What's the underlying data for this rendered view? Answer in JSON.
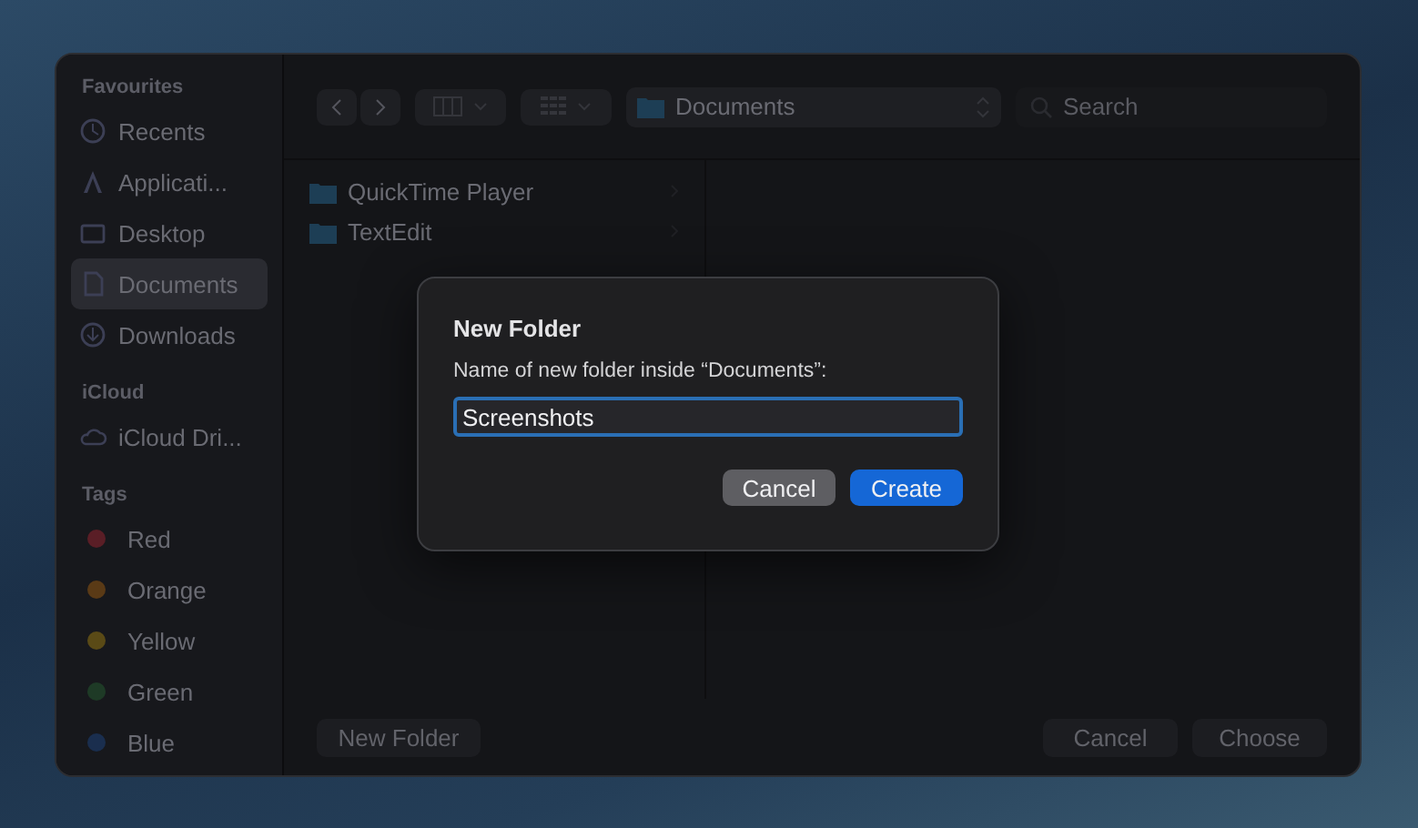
{
  "sidebar": {
    "sections": [
      {
        "title": "Favourites",
        "items": [
          {
            "label": "Recents",
            "kind": "clock",
            "selected": false
          },
          {
            "label": "Applicati...",
            "kind": "apps",
            "selected": false
          },
          {
            "label": "Desktop",
            "kind": "desktop",
            "selected": false
          },
          {
            "label": "Documents",
            "kind": "doc",
            "selected": true
          },
          {
            "label": "Downloads",
            "kind": "download",
            "selected": false
          }
        ]
      },
      {
        "title": "iCloud",
        "items": [
          {
            "label": "iCloud Dri...",
            "kind": "cloud",
            "selected": false
          }
        ]
      },
      {
        "title": "Tags",
        "items": [
          {
            "label": "Red",
            "kind": "tag",
            "color": "#5a1e26",
            "selected": false
          },
          {
            "label": "Orange",
            "kind": "tag",
            "color": "#5a3a16",
            "selected": false
          },
          {
            "label": "Yellow",
            "kind": "tag",
            "color": "#5a4a16",
            "selected": false
          },
          {
            "label": "Green",
            "kind": "tag",
            "color": "#1e3a26",
            "selected": false
          },
          {
            "label": "Blue",
            "kind": "tag",
            "color": "#1a2e4e",
            "selected": false
          }
        ]
      }
    ]
  },
  "toolbar": {
    "location": "Documents",
    "search": {
      "placeholder": "Search"
    }
  },
  "files": [
    {
      "name": "QuickTime Player"
    },
    {
      "name": "TextEdit"
    }
  ],
  "footer": {
    "new_folder": "New Folder",
    "cancel": "Cancel",
    "choose": "Choose"
  },
  "dialog": {
    "title": "New Folder",
    "prompt": "Name of new folder inside “Documents”:",
    "value": "Screenshots",
    "cancel": "Cancel",
    "create": "Create"
  }
}
